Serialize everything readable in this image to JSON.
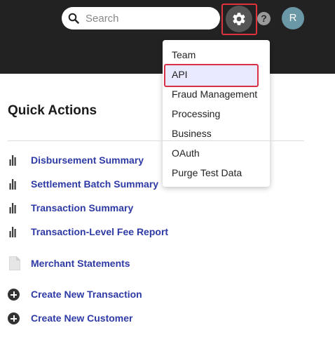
{
  "header": {
    "search_placeholder": "Search",
    "help_label": "?",
    "avatar_initial": "R"
  },
  "settings_menu": {
    "items": [
      {
        "label": "Team"
      },
      {
        "label": "API",
        "highlighted": true
      },
      {
        "label": "Fraud Management"
      },
      {
        "label": "Processing"
      },
      {
        "label": "Business"
      },
      {
        "label": "OAuth"
      },
      {
        "label": "Purge Test Data"
      }
    ]
  },
  "quick_actions": {
    "title": "Quick Actions",
    "links": [
      {
        "label": "Disbursement Summary",
        "icon": "report-icon"
      },
      {
        "label": "Settlement Batch Summary",
        "icon": "report-icon"
      },
      {
        "label": "Transaction Summary",
        "icon": "report-icon"
      },
      {
        "label": "Transaction-Level Fee Report",
        "icon": "report-icon"
      },
      {
        "label": "Merchant Statements",
        "icon": "document-icon"
      },
      {
        "label": "Create New Transaction",
        "icon": "plus-circle-icon"
      },
      {
        "label": "Create New Customer",
        "icon": "plus-circle-icon"
      }
    ]
  },
  "colors": {
    "topbar": "#222222",
    "link": "#2e3aa5",
    "highlight_border": "#e0323c",
    "menu_highlight_bg": "#e9e9ff"
  }
}
